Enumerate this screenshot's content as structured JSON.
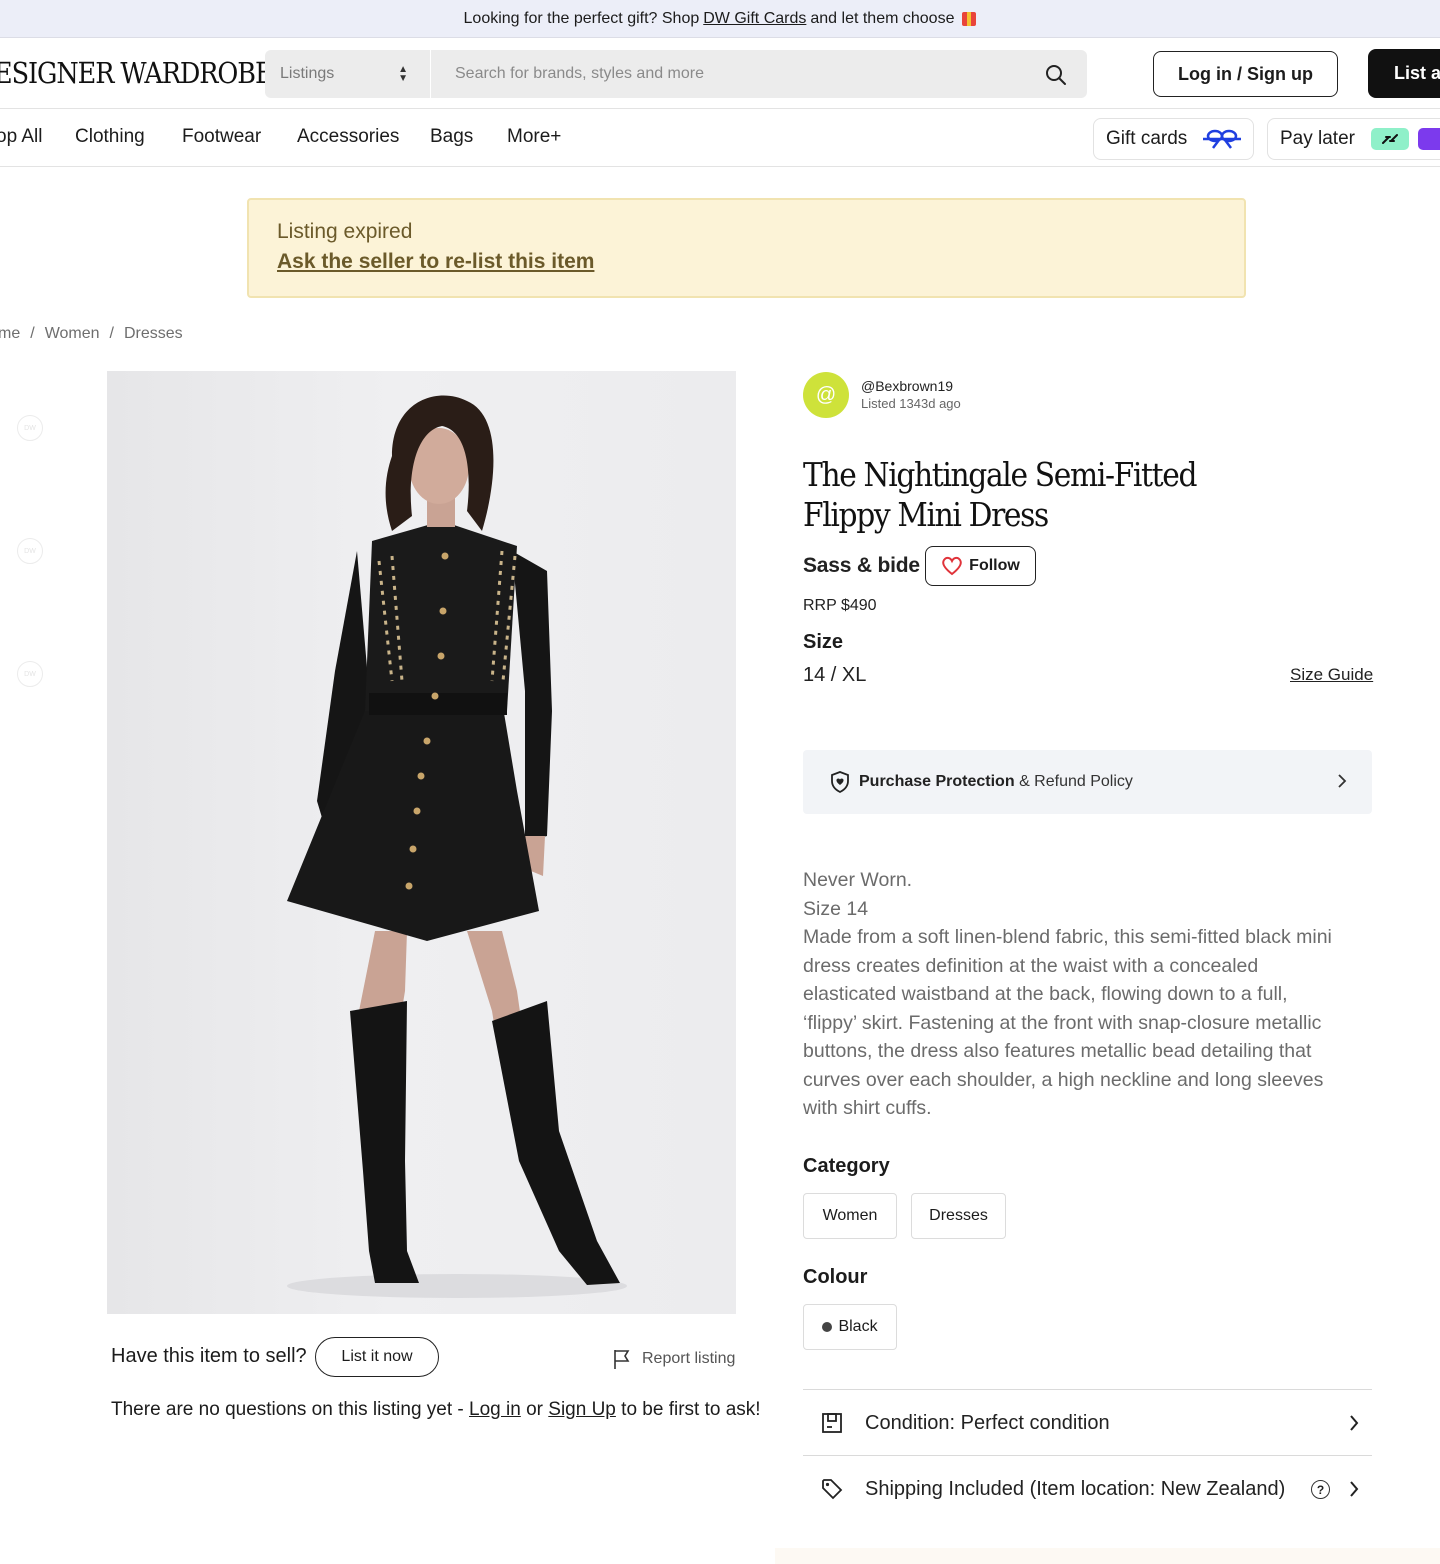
{
  "promo": {
    "before": "Looking for the perfect gift? Shop",
    "link": "DW Gift Cards",
    "after": "and let them choose"
  },
  "header": {
    "logo": "ESIGNER WARDROBE",
    "search_type": "Listings",
    "search_placeholder": "Search for brands, styles and more",
    "login_label": "Log in / Sign up",
    "list_label": "List a"
  },
  "nav": {
    "items": [
      "op All",
      "Clothing",
      "Footwear",
      "Accessories",
      "Bags",
      "More+"
    ],
    "gift_cards": "Gift cards",
    "pay_later": "Pay later"
  },
  "banner": {
    "title": "Listing expired",
    "link": "Ask the seller to re-list this item"
  },
  "breadcrumb": [
    "me",
    "Women",
    "Dresses"
  ],
  "gallery": {
    "thumb_label": "DW",
    "sell_prompt": "Have this item to sell?",
    "list_now": "List it now",
    "report": "Report listing",
    "questions_before": "There are no questions on this listing yet -",
    "login_link": "Log in",
    "or": "or",
    "signup_link": "Sign Up",
    "questions_after": "to be first to ask!"
  },
  "seller": {
    "avatar_glyph": "@",
    "handle": "@Bexbrown19",
    "listed": "Listed 1343d ago"
  },
  "product": {
    "title": "The Nightingale Semi-Fitted Flippy Mini Dress",
    "brand": "Sass & bide",
    "follow": "Follow",
    "rrp": "RRP $490",
    "size_heading": "Size",
    "size_value": "14 / XL",
    "size_guide": "Size Guide",
    "protection_bold": "Purchase Protection",
    "protection_rest": "& Refund Policy",
    "description": [
      "Never Worn.",
      "Size 14",
      "Made from a soft linen-blend fabric, this semi-fitted black mini dress creates definition at the waist with a concealed elasticated waistband at the back, flowing down to a full, ‘flippy’ skirt. Fastening at the front with snap-closure metallic buttons, the dress also features metallic bead detailing that curves over each shoulder, a high neckline and long sleeves with shirt cuffs."
    ],
    "category_heading": "Category",
    "categories": [
      "Women",
      "Dresses"
    ],
    "colour_heading": "Colour",
    "colour": "Black",
    "condition_label": "Condition:",
    "condition_value": "Perfect condition",
    "shipping_label": "Shipping Included",
    "shipping_location": "(Item location: New Zealand)"
  },
  "colors": {
    "banner_bg": "#fcf3d7",
    "avatar": "#cee23a",
    "heart": "#e0333a",
    "gift_icon": "#1f3fe0",
    "pay_later_green": "#8ff0c9",
    "pay_later_purple": "#7c3aed"
  }
}
